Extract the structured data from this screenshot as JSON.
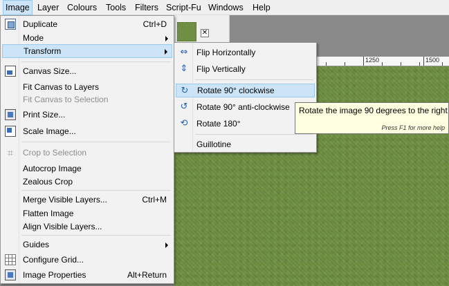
{
  "menubar": {
    "items": [
      {
        "label": "Image"
      },
      {
        "label": "Layer"
      },
      {
        "label": "Colours"
      },
      {
        "label": "Tools"
      },
      {
        "label": "Filters"
      },
      {
        "label": "Script-Fu"
      },
      {
        "label": "Windows"
      },
      {
        "label": "Help"
      }
    ]
  },
  "tab": {
    "close_glyph": "✕"
  },
  "ruler": {
    "labels": [
      "1250",
      "1500"
    ]
  },
  "image_menu": {
    "items": [
      {
        "label": "Duplicate",
        "shortcut": "Ctrl+D",
        "icon": "duplicate-icon"
      },
      {
        "label": "Mode",
        "submenu": true
      },
      {
        "label": "Transform",
        "submenu": true,
        "highlighted": true
      },
      {
        "label": "Canvas Size...",
        "icon": "canvas-size-icon"
      },
      {
        "label": "Fit Canvas to Layers"
      },
      {
        "label": "Fit Canvas to Selection",
        "disabled": true
      },
      {
        "label": "Print Size...",
        "icon": "print-size-icon"
      },
      {
        "label": "Scale Image...",
        "icon": "scale-image-icon"
      },
      {
        "label": "Crop to Selection",
        "disabled": true,
        "icon": "crop-icon"
      },
      {
        "label": "Autocrop Image"
      },
      {
        "label": "Zealous Crop"
      },
      {
        "label": "Merge Visible Layers...",
        "shortcut": "Ctrl+M"
      },
      {
        "label": "Flatten Image"
      },
      {
        "label": "Align Visible Layers..."
      },
      {
        "label": "Guides",
        "submenu": true
      },
      {
        "label": "Configure Grid...",
        "icon": "grid-icon"
      },
      {
        "label": "Image Properties",
        "shortcut": "Alt+Return",
        "icon": "image-properties-icon"
      }
    ]
  },
  "transform_menu": {
    "items": [
      {
        "label": "Flip Horizontally",
        "icon": "flip-horizontal-icon"
      },
      {
        "label": "Flip Vertically",
        "icon": "flip-vertical-icon"
      },
      {
        "label": "Rotate 90° clockwise",
        "icon": "rotate-cw-icon",
        "highlighted": true
      },
      {
        "label": "Rotate 90° anti-clockwise",
        "icon": "rotate-ccw-icon"
      },
      {
        "label": "Rotate 180°",
        "icon": "rotate-180-icon"
      },
      {
        "label": "Guillotine"
      }
    ]
  },
  "tooltip": {
    "text": "Rotate the image 90 degrees to the right",
    "help": "Press F1 for more help"
  },
  "colors": {
    "menu_bg": "#f2f2f2",
    "highlight": "#cce4f7",
    "highlight_border": "#99c9ef",
    "disabled_text": "#8d8d8d",
    "canvas_grass": "#6c8d3f",
    "tooltip_bg": "#ffffe1"
  }
}
